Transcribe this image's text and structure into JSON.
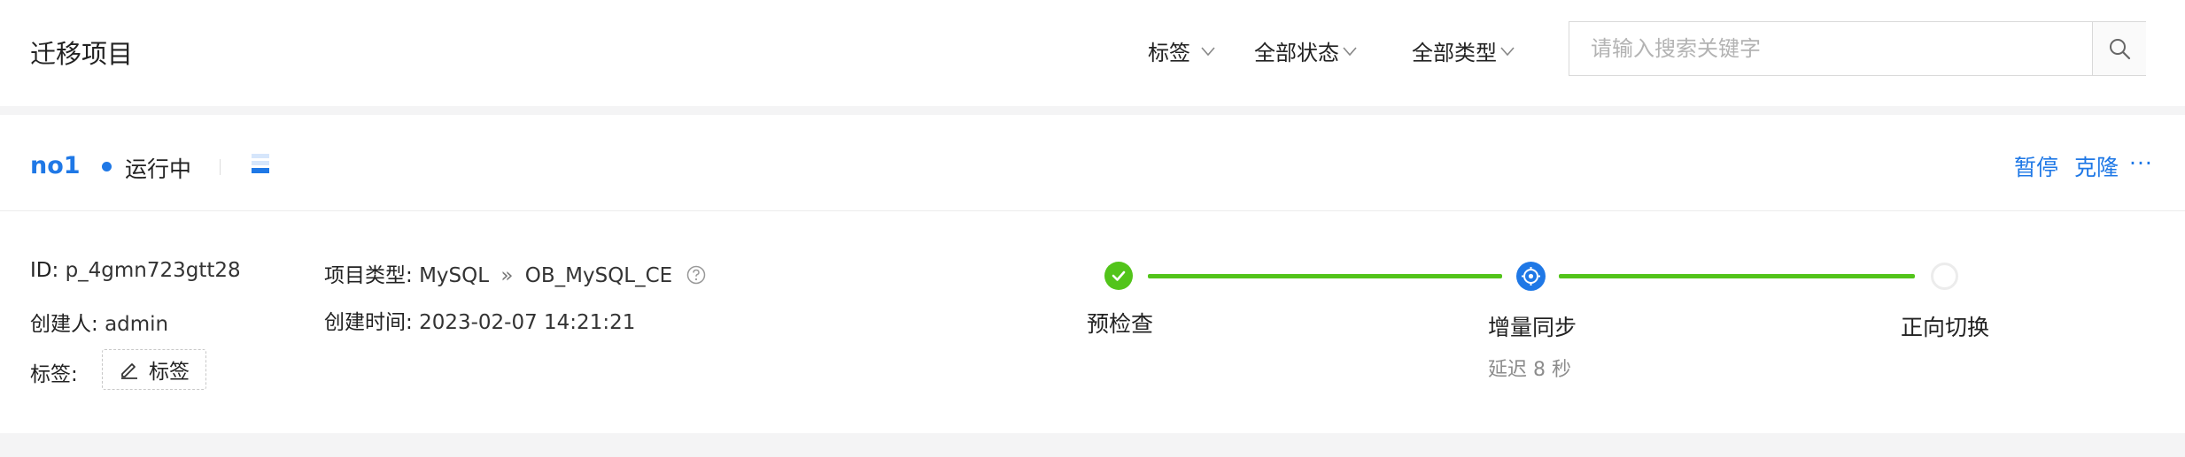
{
  "header": {
    "title": "迁移项目",
    "filters": [
      {
        "label": "标签"
      },
      {
        "label": "全部状态"
      },
      {
        "label": "全部类型"
      }
    ],
    "search": {
      "placeholder": "请输入搜索关键字",
      "value": ""
    }
  },
  "project": {
    "name": "no1",
    "status": "运行中",
    "status_color": "#1f78e6",
    "actions": {
      "pause": "暂停",
      "clone": "克隆",
      "more": "···"
    },
    "id_label": "ID:",
    "id_value": "p_4gmn723gtt28",
    "creator_label": "创建人:",
    "creator_value": "admin",
    "tags_label": "标签:",
    "tag_button_label": "标签",
    "type_label": "项目类型:",
    "source_type": "MySQL",
    "arrow": "»",
    "target_type": "OB_MySQL_CE",
    "created_label": "创建时间:",
    "created_value": "2023-02-07 14:21:21",
    "steps": [
      {
        "label": "预检查",
        "state": "done"
      },
      {
        "label": "增量同步",
        "state": "active",
        "sub": "延迟 8 秒"
      },
      {
        "label": "正向切换",
        "state": "pending"
      }
    ]
  },
  "colors": {
    "accent": "#1f78e6",
    "success": "#52c41a",
    "muted": "#8c8c8c"
  }
}
